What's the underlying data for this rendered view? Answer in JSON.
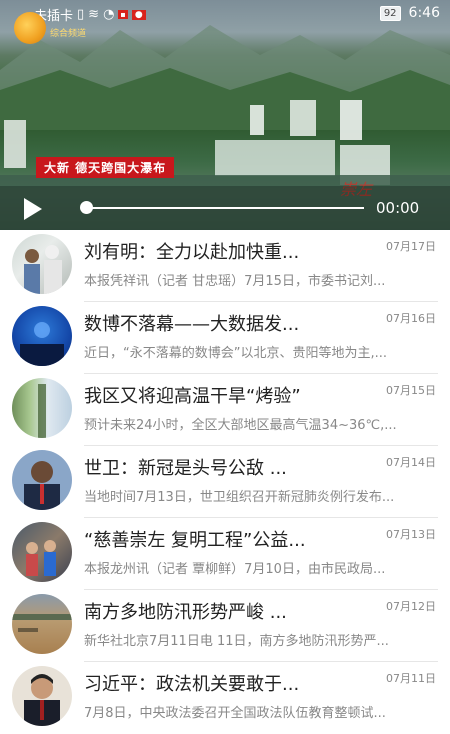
{
  "status_bar": {
    "carrier": "未插卡",
    "battery": "92",
    "time": "6:46"
  },
  "video": {
    "logo_text": "综合频道",
    "caption": "大新 德天跨国大瀑布",
    "watermark": "崇左",
    "duration": "00:00",
    "progress": 0
  },
  "news": [
    {
      "title": "刘有明：全力以赴加快重...",
      "date": "07月17日",
      "summary": "本报凭祥讯（记者 甘忠瑶）7月15日，市委书记刘..."
    },
    {
      "title": "数博不落幕——大数据发...",
      "date": "07月16日",
      "summary": "近日，“永不落幕的数博会”以北京、贵阳等地为主,..."
    },
    {
      "title": "我区又将迎高温干旱“烤验”",
      "date": "07月15日",
      "summary": "预计未来24小时，全区大部地区最高气温34~36℃,..."
    },
    {
      "title": "世卫：新冠是头号公敌 ...",
      "date": "07月14日",
      "summary": "当地时间7月13日，世卫组织召开新冠肺炎例行发布..."
    },
    {
      "title": "“慈善崇左 复明工程”公益...",
      "date": "07月13日",
      "summary": "本报龙州讯（记者 覃柳鲜）7月10日，由市民政局..."
    },
    {
      "title": "南方多地防汛形势严峻 ...",
      "date": "07月12日",
      "summary": "新华社北京7月11日电 11日，南方多地防汛形势严..."
    },
    {
      "title": "习近平：政法机关要敢于...",
      "date": "07月11日",
      "summary": "7月8日，中央政法委召开全国政法队伍教育整顿试..."
    }
  ]
}
